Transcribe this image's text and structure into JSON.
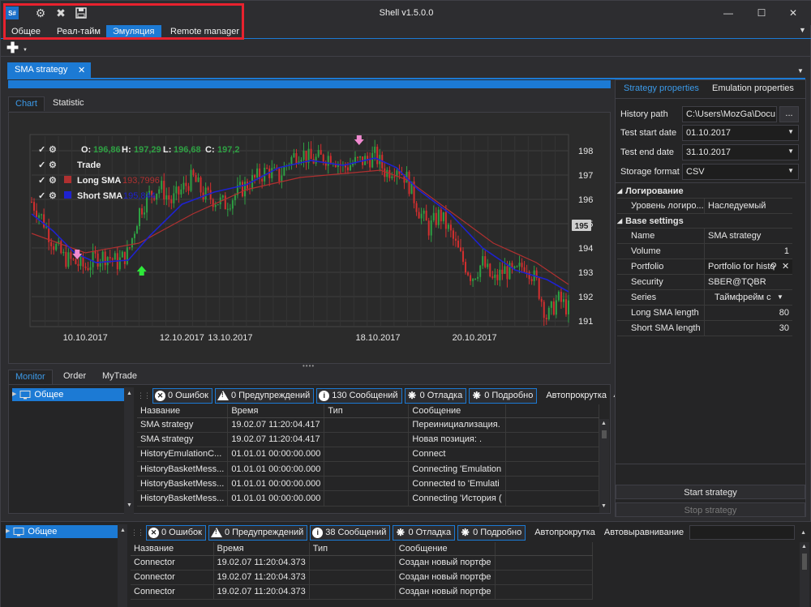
{
  "window": {
    "title": "Shell v1.5.0.0",
    "logo": "S#"
  },
  "ribbon": {
    "tabs": [
      "Общее",
      "Реал-тайм",
      "Эмуляция",
      "Remote manager"
    ],
    "active": 2
  },
  "document_tab": {
    "label": "SMA strategy"
  },
  "progress": {
    "fraction": 1.0
  },
  "chart_tabs": [
    "Chart",
    "Statistic"
  ],
  "chart_legend": {
    "ohlc": {
      "o_label": "O:",
      "o": "196,86",
      "h_label": "H:",
      "h": "197,29",
      "l_label": "L:",
      "l": "196,68",
      "c_label": "C:",
      "c": "197,2"
    },
    "trade": "Trade",
    "long_sma": {
      "name": "Long SMA",
      "value": "193,7996"
    },
    "short_sma": {
      "name": "Short SMA",
      "value": "195,844"
    }
  },
  "colors": {
    "accent": "#1c7ad4",
    "up": "#2ea043",
    "down": "#d32f2f",
    "long_sma": "#b03030",
    "short_sma": "#1e22d0",
    "highlight": "#e8222e"
  },
  "chart_data": {
    "type": "candlestick",
    "y_ticks": [
      191,
      192,
      193,
      194,
      195,
      196,
      197,
      198
    ],
    "ylim": [
      190.8,
      198.6
    ],
    "current_price": "195",
    "x_tick_labels": [
      "10.10.2017",
      "12.10.2017",
      "13.10.2017",
      "18.10.2017",
      "20.10.2017"
    ],
    "x_tick_positions": [
      0.1,
      0.28,
      0.37,
      0.645,
      0.825
    ],
    "close_path": [
      [
        0,
        195.9
      ],
      [
        0.02,
        195.2
      ],
      [
        0.04,
        194.2
      ],
      [
        0.06,
        193.6
      ],
      [
        0.08,
        193.4
      ],
      [
        0.1,
        193.2
      ],
      [
        0.12,
        193.6
      ],
      [
        0.14,
        193.7
      ],
      [
        0.16,
        193.4
      ],
      [
        0.18,
        193.8
      ],
      [
        0.2,
        195.5
      ],
      [
        0.22,
        196.2
      ],
      [
        0.24,
        196.5
      ],
      [
        0.26,
        195.9
      ],
      [
        0.28,
        196.4
      ],
      [
        0.3,
        196.9
      ],
      [
        0.32,
        196.2
      ],
      [
        0.34,
        196.0
      ],
      [
        0.36,
        195.8
      ],
      [
        0.38,
        196.2
      ],
      [
        0.4,
        196.6
      ],
      [
        0.42,
        196.9
      ],
      [
        0.44,
        197.2
      ],
      [
        0.46,
        196.9
      ],
      [
        0.48,
        197.6
      ],
      [
        0.5,
        198.0
      ],
      [
        0.52,
        197.6
      ],
      [
        0.54,
        197.7
      ],
      [
        0.56,
        197.8
      ],
      [
        0.58,
        197.3
      ],
      [
        0.6,
        197.5
      ],
      [
        0.62,
        197.6
      ],
      [
        0.64,
        197.8
      ],
      [
        0.66,
        197.1
      ],
      [
        0.68,
        197.4
      ],
      [
        0.7,
        196.8
      ],
      [
        0.72,
        195.6
      ],
      [
        0.74,
        194.8
      ],
      [
        0.76,
        195.4
      ],
      [
        0.78,
        194.6
      ],
      [
        0.8,
        193.6
      ],
      [
        0.82,
        192.8
      ],
      [
        0.84,
        193.4
      ],
      [
        0.86,
        192.6
      ],
      [
        0.88,
        193.1
      ],
      [
        0.9,
        192.9
      ],
      [
        0.92,
        193.4
      ],
      [
        0.94,
        192.6
      ],
      [
        0.96,
        191.1
      ],
      [
        0.98,
        191.9
      ],
      [
        1.0,
        191.5
      ]
    ],
    "long_sma_path": [
      [
        0,
        194.6
      ],
      [
        0.1,
        193.8
      ],
      [
        0.2,
        194.2
      ],
      [
        0.3,
        195.4
      ],
      [
        0.4,
        196.4
      ],
      [
        0.5,
        196.9
      ],
      [
        0.6,
        197.1
      ],
      [
        0.65,
        197.2
      ],
      [
        0.7,
        196.8
      ],
      [
        0.78,
        195.5
      ],
      [
        0.86,
        194.2
      ],
      [
        0.94,
        193.4
      ],
      [
        1.0,
        192.5
      ]
    ],
    "short_sma_path": [
      [
        0,
        195.4
      ],
      [
        0.04,
        194.7
      ],
      [
        0.08,
        193.8
      ],
      [
        0.12,
        193.4
      ],
      [
        0.18,
        193.5
      ],
      [
        0.22,
        194.5
      ],
      [
        0.28,
        195.8
      ],
      [
        0.34,
        196.3
      ],
      [
        0.4,
        196.6
      ],
      [
        0.46,
        197.3
      ],
      [
        0.52,
        197.6
      ],
      [
        0.58,
        197.4
      ],
      [
        0.64,
        197.7
      ],
      [
        0.68,
        197.3
      ],
      [
        0.72,
        196.4
      ],
      [
        0.78,
        195.4
      ],
      [
        0.84,
        194.0
      ],
      [
        0.9,
        193.1
      ],
      [
        0.96,
        192.7
      ],
      [
        1.0,
        192.2
      ]
    ],
    "trades": [
      {
        "x": 0.085,
        "y": 193.6,
        "side": "sell"
      },
      {
        "x": 0.205,
        "y": 193.2,
        "side": "buy"
      },
      {
        "x": 0.61,
        "y": 198.3,
        "side": "sell"
      }
    ]
  },
  "monitor": {
    "tabs": [
      "Monitor",
      "Order",
      "MyTrade"
    ],
    "tree_root": "Общее",
    "filters": {
      "errors": "0 Ошибок",
      "warnings": "0 Предупреждений",
      "messages": "130 Сообщений",
      "debug": "0 Отладка",
      "verbose": "0 Подробно",
      "autoscroll": "Автопрокрутка"
    },
    "columns": [
      "Название",
      "Время",
      "Тип",
      "Сообщение"
    ],
    "rows": [
      [
        "SMA strategy",
        "19.02.07 11:20:04.417",
        "",
        "Переинициализация."
      ],
      [
        "SMA strategy",
        "19.02.07 11:20:04.417",
        "",
        "Новая позиция: ."
      ],
      [
        "HistoryEmulationC...",
        "01.01.01 00:00:00.000",
        "",
        "Connect"
      ],
      [
        "HistoryBasketMess...",
        "01.01.01 00:00:00.000",
        "",
        "Connecting 'Emulation"
      ],
      [
        "HistoryBasketMess...",
        "01.01.01 00:00:00.000",
        "",
        "Connected to 'Emulati"
      ],
      [
        "HistoryBasketMess...",
        "01.01.01 00:00:00.000",
        "",
        "Connecting 'История ("
      ]
    ]
  },
  "right_panel": {
    "tabs": [
      "Strategy properties",
      "Emulation properties"
    ],
    "history_path": {
      "label": "History path",
      "value": "C:\\Users\\MozGa\\Docu",
      "browse": "..."
    },
    "start_date": {
      "label": "Test start date",
      "value": "01.10.2017"
    },
    "end_date": {
      "label": "Test end date",
      "value": "31.10.2017"
    },
    "storage": {
      "label": "Storage format",
      "value": "CSV"
    },
    "group_logging": "Логирование",
    "log_level": {
      "name": "Уровень логиро...",
      "value": "Наследуемый"
    },
    "group_base": "Base settings",
    "props": [
      {
        "name": "Name",
        "value": "SMA strategy"
      },
      {
        "name": "Volume",
        "value": "1"
      },
      {
        "name": "Portfolio",
        "value": "Portfolio for histo"
      },
      {
        "name": "Security",
        "value": "SBER@TQBR"
      },
      {
        "name": "Series",
        "value": "Таймфрейм с"
      },
      {
        "name": "Long SMA length",
        "value": "80"
      },
      {
        "name": "Short SMA length",
        "value": "30"
      }
    ],
    "start_button": "Start strategy",
    "stop_button": "Stop strategy"
  },
  "bottom_log": {
    "tree_root": "Общее",
    "filters": {
      "errors": "0 Ошибок",
      "warnings": "0 Предупреждений",
      "messages": "38 Сообщений",
      "debug": "0 Отладка",
      "verbose": "0 Подробно",
      "autoscroll": "Автопрокрутка",
      "autoalign": "Автовыравнивание"
    },
    "columns": [
      "Название",
      "Время",
      "Тип",
      "Сообщение"
    ],
    "rows": [
      [
        "Connector",
        "19.02.07 11:20:04.373",
        "",
        "Создан новый портфе"
      ],
      [
        "Connector",
        "19.02.07 11:20:04.373",
        "",
        "Создан новый портфе"
      ],
      [
        "Connector",
        "19.02.07 11:20:04.373",
        "",
        "Создан новый портфе"
      ]
    ]
  }
}
